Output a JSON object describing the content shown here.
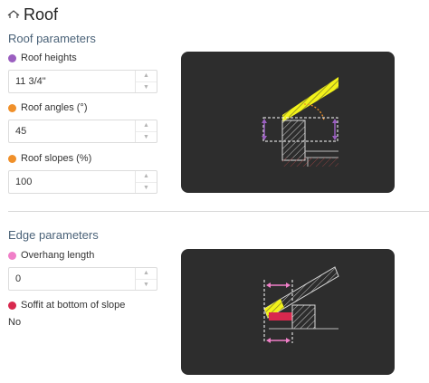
{
  "header": {
    "title": "Roof",
    "icon": "roof-icon"
  },
  "roof_section": {
    "title": "Roof parameters",
    "params": [
      {
        "label": "Roof heights",
        "value": "11 3/4\"",
        "color": "#9b5fc0"
      },
      {
        "label": "Roof angles (°)",
        "value": "45",
        "color": "#f0902a"
      },
      {
        "label": "Roof slopes (%)",
        "value": "100",
        "color": "#f0902a"
      }
    ]
  },
  "edge_section": {
    "title": "Edge parameters",
    "overhang": {
      "label": "Overhang length",
      "value": "0",
      "color": "#f07fc8"
    },
    "soffit": {
      "label": "Soffit at bottom of slope",
      "value": "No",
      "color": "#d8294e"
    }
  },
  "colors": {
    "panel_bg": "#2d2d2d",
    "roof_yellow": "#f2f21a",
    "height_purple": "#9b5fc0",
    "angle_orange": "#f0902a",
    "overhang_pink": "#f07fc8",
    "soffit_red": "#d8294e",
    "wall_hatch": "#8a3f3f"
  }
}
